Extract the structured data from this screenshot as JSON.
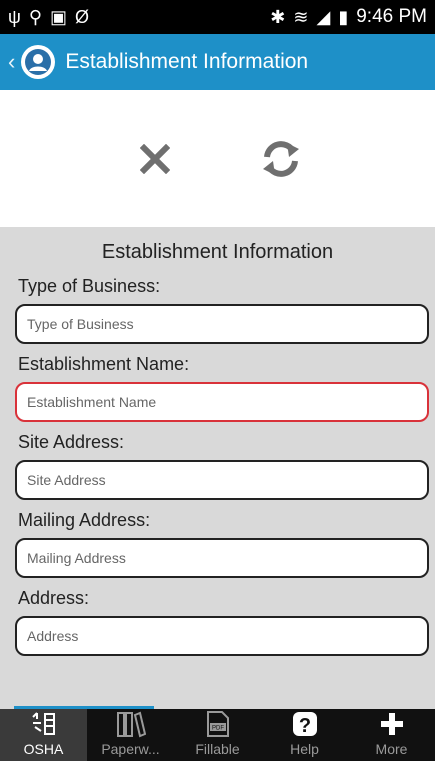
{
  "status_bar": {
    "left_icons": [
      "usb-icon",
      "location-icon",
      "image-icon",
      "swipe-icon"
    ],
    "left_glyphs": [
      "ψ",
      "⚲",
      "▣",
      "Ø"
    ],
    "right_glyphs": [
      "✱",
      "≋",
      "◢",
      "▮"
    ],
    "right_icons": [
      "bluetooth-icon",
      "wifi-icon",
      "signal-icon",
      "battery-icon"
    ],
    "time": "9:46 PM"
  },
  "app_bar": {
    "back": "‹",
    "title": "Establishment Information",
    "color": "#1e90c8"
  },
  "actions": {
    "clear_icon": "close-icon",
    "sync_icon": "refresh-icon"
  },
  "form": {
    "title": "Establishment Information",
    "fields": [
      {
        "label": "Type of Business:",
        "placeholder": "Type of Business"
      },
      {
        "label": "Establishment Name:",
        "placeholder": "Establishment Name",
        "error": true
      },
      {
        "label": "Site Address:",
        "placeholder": "Site Address"
      },
      {
        "label": "Mailing Address:",
        "placeholder": "Mailing Address"
      },
      {
        "label": "Address:",
        "placeholder": "Address"
      }
    ],
    "error_color": "#d9323a"
  },
  "tabs": [
    {
      "label": "OSHA",
      "icon": "osha-icon",
      "active": true
    },
    {
      "label": "Paperw...",
      "icon": "books-icon",
      "active": false
    },
    {
      "label": "Fillable",
      "icon": "pdf-icon",
      "active": false
    },
    {
      "label": "Help",
      "icon": "help-icon",
      "active": false
    },
    {
      "label": "More",
      "icon": "plus-icon",
      "active": false
    }
  ]
}
